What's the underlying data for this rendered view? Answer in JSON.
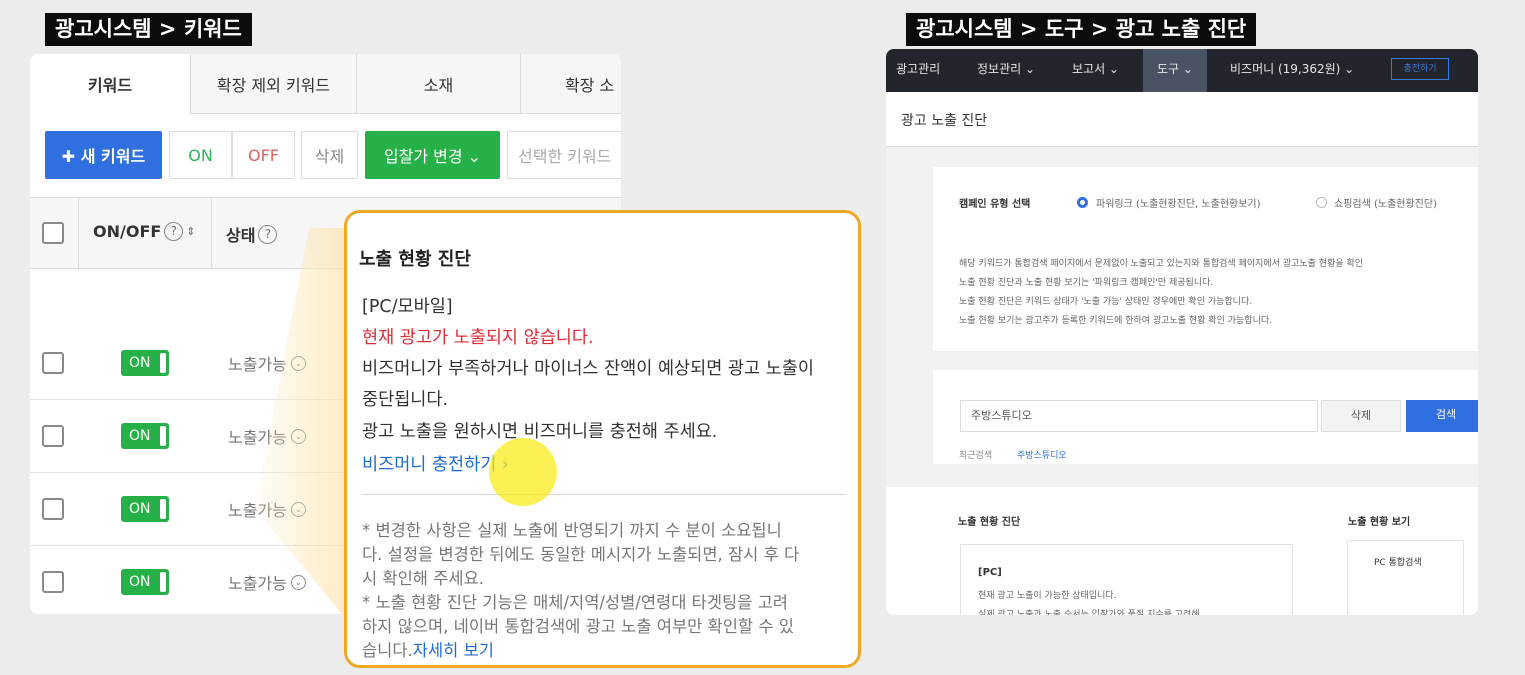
{
  "left_caption": "광고시스템 > 키워드",
  "right_caption": "광고시스템 > 도구 > 광고 노출 진단",
  "left": {
    "tabs": [
      "키워드",
      "확장 제외 키워드",
      "소재",
      "확장 소"
    ],
    "toolbar": {
      "new_keyword": "✚ 새 키워드",
      "on": "ON",
      "off": "OFF",
      "delete": "삭제",
      "bid_change": "입찰가 변경 ⌄",
      "selected": "선택한 키워드"
    },
    "header": {
      "onoff": "ON/OFF",
      "status": "상태",
      "help": "?",
      "sort": "⇕"
    },
    "rows": [
      {
        "toggle": "ON",
        "status": "노출가능"
      },
      {
        "toggle": "ON",
        "status": "노출가능"
      },
      {
        "toggle": "ON",
        "status": "노출가능"
      },
      {
        "toggle": "ON",
        "status": "노출가능"
      }
    ],
    "status_icon": "⌄"
  },
  "tooltip": {
    "title": "노출 현황 진단",
    "device": "[PC/모바일]",
    "alert": "현재 광고가 노출되지 않습니다.",
    "body1": "비즈머니가 부족하거나 마이너스 잔액이 예상되면 광고 노출이",
    "body2": "중단됩니다.",
    "body3": "광고 노출을 원하시면 비즈머니를 충전해 주세요.",
    "charge_link": "비즈머니 충전하기 ›",
    "note1": "* 변경한 사항은 실제 노출에 반영되기 까지 수 분이 소요됩니",
    "note2": "다. 설정을 변경한 뒤에도 동일한 메시지가 노출되면, 잠시 후 다",
    "note3": "시 확인해 주세요.",
    "note4": "* 노출 현황 진단 기능은 매체/지역/성별/연령대 타겟팅을 고려",
    "note5": "하지 않으며, 네이버 통합검색에 광고 노출 여부만 확인할 수 있",
    "note6": "습니다.",
    "more_link": "자세히 보기"
  },
  "right": {
    "nav": [
      "광고관리",
      "정보관리 ⌄",
      "보고서 ⌄",
      "도구 ⌄",
      "비즈머니 (19,362원) ⌄"
    ],
    "nav_charge": "충전하기",
    "page_title": "광고 노출 진단",
    "campaign_label": "캠페인 유형 선택",
    "radio1": "파워링크 (노출현황진단, 노출현황보기)",
    "radio2": "쇼핑검색 (노출현황진단)",
    "desc": [
      "해당 키워드가 통합검색 페이지에서 문제없이 노출되고 있는지와 통합검색 페이지에서 광고노출 현황을 확인",
      "노출 현황 진단과 노출 현황 보기는 '파워링크 캠페인'만 제공됩니다.",
      "노출 현황 진단은 키워드 상태가 '노출 가능' 상태인 경우에만 확인 가능합니다.",
      "노출 현황 보기는 광고주가 등록한 키워드에 한하여 광고노출 현황 확인 가능합니다."
    ],
    "search_value": "주방스튜디오",
    "delete_btn": "삭제",
    "search_btn": "검색",
    "recent_label": "최근검색",
    "recent_item": "주방스튜디오",
    "diag_title": "노출 현황 진단",
    "view_title": "노출 현황 보기",
    "pc_label": "[PC]",
    "pc_text": "현재 광고 노출이 가능한 상태입니다.",
    "pc_text2": "실제 광고 노출과 노출 순서는 입찰가와 품질 지수를 고려해",
    "pc_view": "PC 통합검색"
  }
}
